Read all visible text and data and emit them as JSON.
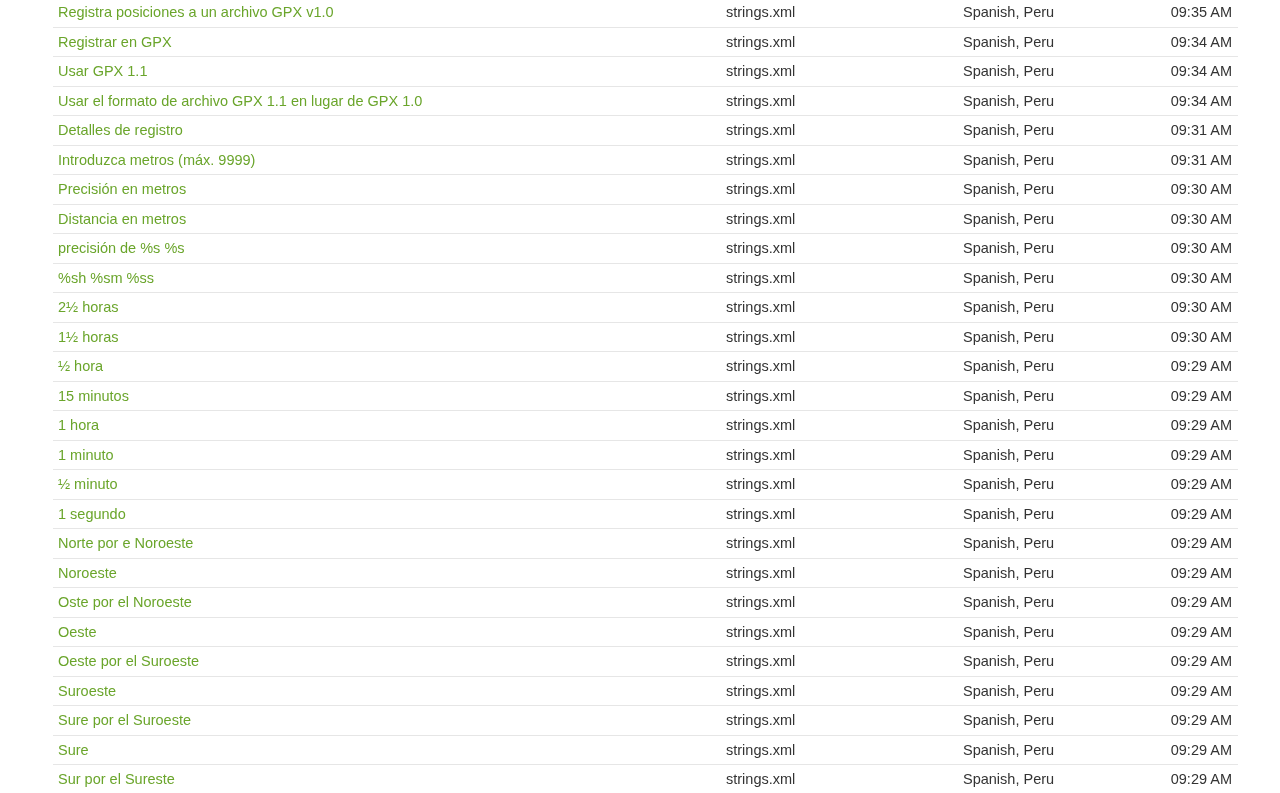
{
  "rows": [
    {
      "text": "Registra posiciones a un archivo GPX v1.0",
      "file": "strings.xml",
      "language": "Spanish, Peru",
      "time": "09:35 AM"
    },
    {
      "text": "Registrar en GPX",
      "file": "strings.xml",
      "language": "Spanish, Peru",
      "time": "09:34 AM"
    },
    {
      "text": "Usar GPX 1.1",
      "file": "strings.xml",
      "language": "Spanish, Peru",
      "time": "09:34 AM"
    },
    {
      "text": "Usar el formato de archivo GPX 1.1 en lugar de GPX 1.0",
      "file": "strings.xml",
      "language": "Spanish, Peru",
      "time": "09:34 AM"
    },
    {
      "text": "Detalles de registro",
      "file": "strings.xml",
      "language": "Spanish, Peru",
      "time": "09:31 AM"
    },
    {
      "text": "Introduzca metros (máx. 9999)",
      "file": "strings.xml",
      "language": "Spanish, Peru",
      "time": "09:31 AM"
    },
    {
      "text": "Precisión en metros",
      "file": "strings.xml",
      "language": "Spanish, Peru",
      "time": "09:30 AM"
    },
    {
      "text": "Distancia en metros",
      "file": "strings.xml",
      "language": "Spanish, Peru",
      "time": "09:30 AM"
    },
    {
      "text": "precisión de %s %s",
      "file": "strings.xml",
      "language": "Spanish, Peru",
      "time": "09:30 AM"
    },
    {
      "text": "%sh %sm %ss",
      "file": "strings.xml",
      "language": "Spanish, Peru",
      "time": "09:30 AM"
    },
    {
      "text": "2½ horas",
      "file": "strings.xml",
      "language": "Spanish, Peru",
      "time": "09:30 AM"
    },
    {
      "text": "1½ horas",
      "file": "strings.xml",
      "language": "Spanish, Peru",
      "time": "09:30 AM"
    },
    {
      "text": "½ hora",
      "file": "strings.xml",
      "language": "Spanish, Peru",
      "time": "09:29 AM"
    },
    {
      "text": "15 minutos",
      "file": "strings.xml",
      "language": "Spanish, Peru",
      "time": "09:29 AM"
    },
    {
      "text": "1 hora",
      "file": "strings.xml",
      "language": "Spanish, Peru",
      "time": "09:29 AM"
    },
    {
      "text": "1 minuto",
      "file": "strings.xml",
      "language": "Spanish, Peru",
      "time": "09:29 AM"
    },
    {
      "text": "½ minuto",
      "file": "strings.xml",
      "language": "Spanish, Peru",
      "time": "09:29 AM"
    },
    {
      "text": "1 segundo",
      "file": "strings.xml",
      "language": "Spanish, Peru",
      "time": "09:29 AM"
    },
    {
      "text": "Norte por e Noroeste",
      "file": "strings.xml",
      "language": "Spanish, Peru",
      "time": "09:29 AM"
    },
    {
      "text": "Noroeste",
      "file": "strings.xml",
      "language": "Spanish, Peru",
      "time": "09:29 AM"
    },
    {
      "text": "Oste por el Noroeste",
      "file": "strings.xml",
      "language": "Spanish, Peru",
      "time": "09:29 AM"
    },
    {
      "text": "Oeste",
      "file": "strings.xml",
      "language": "Spanish, Peru",
      "time": "09:29 AM"
    },
    {
      "text": "Oeste por el Suroeste",
      "file": "strings.xml",
      "language": "Spanish, Peru",
      "time": "09:29 AM"
    },
    {
      "text": "Suroeste",
      "file": "strings.xml",
      "language": "Spanish, Peru",
      "time": "09:29 AM"
    },
    {
      "text": "Sure por el Suroeste",
      "file": "strings.xml",
      "language": "Spanish, Peru",
      "time": "09:29 AM"
    },
    {
      "text": "Sure",
      "file": "strings.xml",
      "language": "Spanish, Peru",
      "time": "09:29 AM"
    },
    {
      "text": "Sur por el Sureste",
      "file": "strings.xml",
      "language": "Spanish, Peru",
      "time": "09:29 AM"
    }
  ]
}
